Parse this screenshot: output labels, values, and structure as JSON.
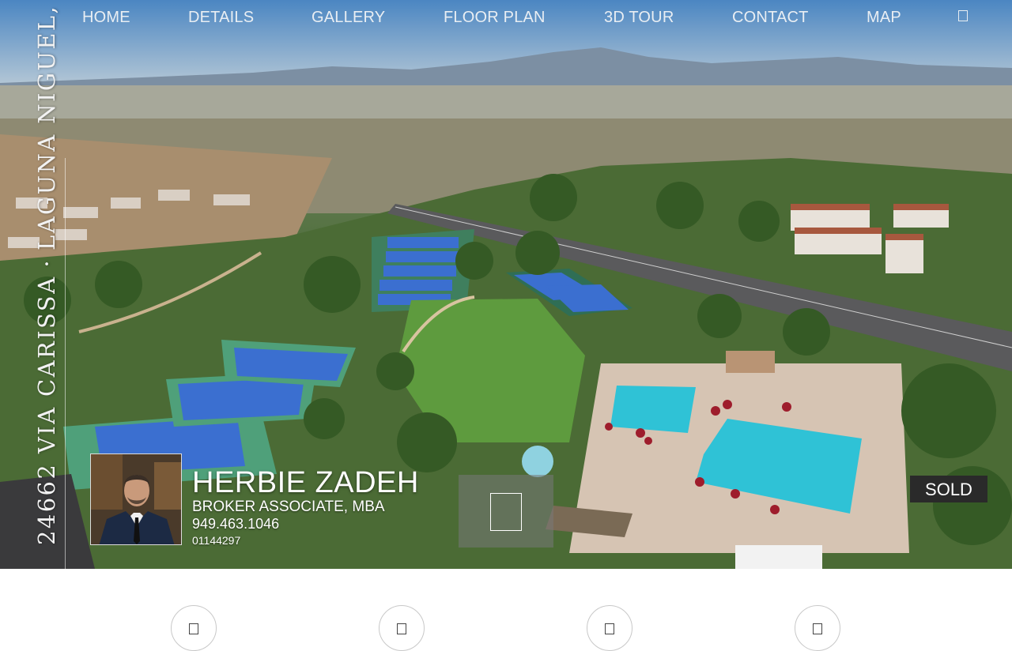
{
  "nav": {
    "items": [
      {
        "label": "HOME"
      },
      {
        "label": "DETAILS"
      },
      {
        "label": "GALLERY"
      },
      {
        "label": "FLOOR PLAN"
      },
      {
        "label": "3D TOUR"
      },
      {
        "label": "CONTACT"
      },
      {
        "label": "MAP"
      }
    ],
    "extra_icon": "menu-icon"
  },
  "address": {
    "street": "24662 VIA CARISSA",
    "separator": "·",
    "city": "LAGUNA NIGUEL, CA"
  },
  "agent": {
    "name": "HERBIE ZADEH",
    "title": "BROKER ASSOCIATE, MBA",
    "phone": "949.463.1046",
    "license": "01144297"
  },
  "status": {
    "label": "SOLD"
  },
  "video": {
    "icon": "play-icon"
  },
  "features": [
    {
      "icon": "feature-icon-1"
    },
    {
      "icon": "feature-icon-2"
    },
    {
      "icon": "feature-icon-3"
    },
    {
      "icon": "feature-icon-4"
    }
  ],
  "colors": {
    "nav_text": "#e9eef3",
    "badge_bg": "#2a2a2a",
    "pool": "#2fc2d6",
    "court": "#3b6fd0"
  }
}
